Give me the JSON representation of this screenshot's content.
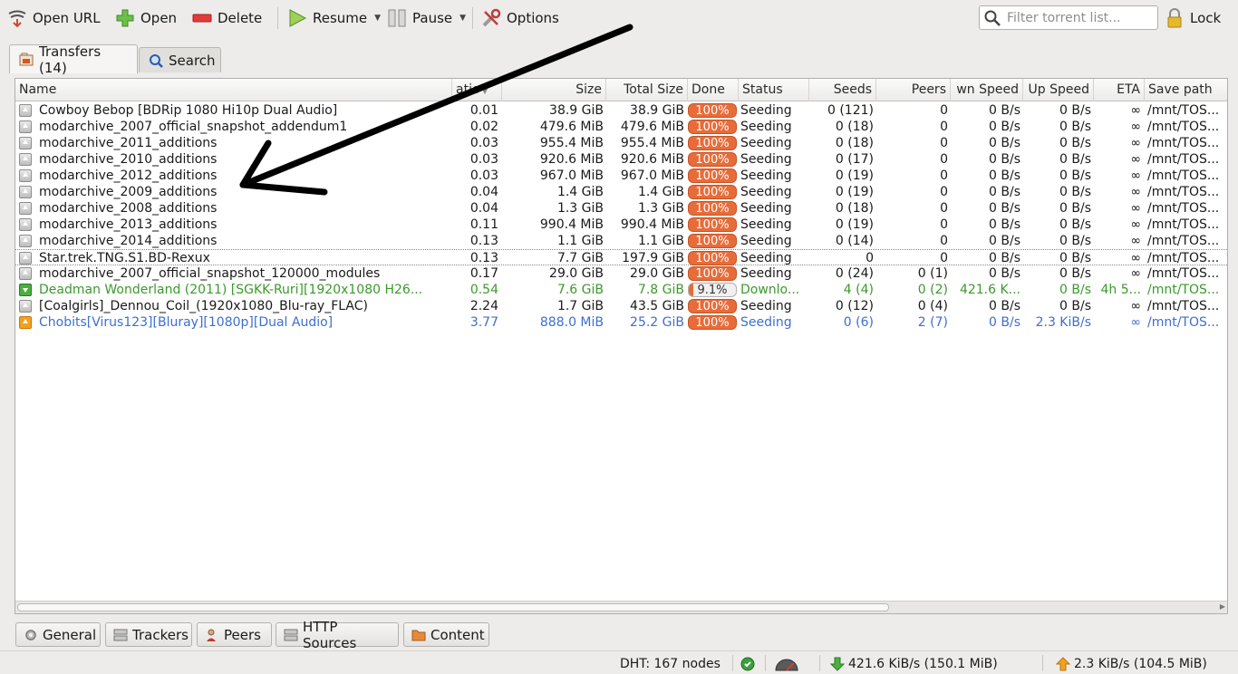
{
  "toolbar": {
    "open_url": "Open URL",
    "open": "Open",
    "delete": "Delete",
    "resume": "Resume",
    "pause": "Pause",
    "options": "Options",
    "filter_placeholder": "Filter torrent list...",
    "lock": "Lock"
  },
  "tabs": {
    "transfers": "Transfers (14)",
    "search": "Search"
  },
  "columns": {
    "name": "Name",
    "ratio": "atio",
    "size": "Size",
    "total_size": "Total Size",
    "done": "Done",
    "status": "Status",
    "seeds": "Seeds",
    "peers": "Peers",
    "down_speed": "wn Speed",
    "up_speed": "Up Speed",
    "eta": "ETA",
    "save_path": "Save path"
  },
  "rows": [
    {
      "name": "Cowboy Bebop [BDRip 1080 Hi10p Dual Audio]",
      "ratio": "0.01",
      "size": "38.9 GiB",
      "total": "38.9 GiB",
      "done": "100%",
      "status": "Seeding",
      "seeds": "0 (121)",
      "peers": "0",
      "down": "0 B/s",
      "up": "0 B/s",
      "eta": "∞",
      "path": "/mnt/TOS..."
    },
    {
      "name": "modarchive_2007_official_snapshot_addendum1",
      "ratio": "0.02",
      "size": "479.6 MiB",
      "total": "479.6 MiB",
      "done": "100%",
      "status": "Seeding",
      "seeds": "0 (18)",
      "peers": "0",
      "down": "0 B/s",
      "up": "0 B/s",
      "eta": "∞",
      "path": "/mnt/TOS..."
    },
    {
      "name": "modarchive_2011_additions",
      "ratio": "0.03",
      "size": "955.4 MiB",
      "total": "955.4 MiB",
      "done": "100%",
      "status": "Seeding",
      "seeds": "0 (18)",
      "peers": "0",
      "down": "0 B/s",
      "up": "0 B/s",
      "eta": "∞",
      "path": "/mnt/TOS..."
    },
    {
      "name": "modarchive_2010_additions",
      "ratio": "0.03",
      "size": "920.6 MiB",
      "total": "920.6 MiB",
      "done": "100%",
      "status": "Seeding",
      "seeds": "0 (17)",
      "peers": "0",
      "down": "0 B/s",
      "up": "0 B/s",
      "eta": "∞",
      "path": "/mnt/TOS..."
    },
    {
      "name": "modarchive_2012_additions",
      "ratio": "0.03",
      "size": "967.0 MiB",
      "total": "967.0 MiB",
      "done": "100%",
      "status": "Seeding",
      "seeds": "0 (19)",
      "peers": "0",
      "down": "0 B/s",
      "up": "0 B/s",
      "eta": "∞",
      "path": "/mnt/TOS..."
    },
    {
      "name": "modarchive_2009_additions",
      "ratio": "0.04",
      "size": "1.4 GiB",
      "total": "1.4 GiB",
      "done": "100%",
      "status": "Seeding",
      "seeds": "0 (19)",
      "peers": "0",
      "down": "0 B/s",
      "up": "0 B/s",
      "eta": "∞",
      "path": "/mnt/TOS..."
    },
    {
      "name": "modarchive_2008_additions",
      "ratio": "0.04",
      "size": "1.3 GiB",
      "total": "1.3 GiB",
      "done": "100%",
      "status": "Seeding",
      "seeds": "0 (18)",
      "peers": "0",
      "down": "0 B/s",
      "up": "0 B/s",
      "eta": "∞",
      "path": "/mnt/TOS..."
    },
    {
      "name": "modarchive_2013_additions",
      "ratio": "0.11",
      "size": "990.4 MiB",
      "total": "990.4 MiB",
      "done": "100%",
      "status": "Seeding",
      "seeds": "0 (19)",
      "peers": "0",
      "down": "0 B/s",
      "up": "0 B/s",
      "eta": "∞",
      "path": "/mnt/TOS..."
    },
    {
      "name": "modarchive_2014_additions",
      "ratio": "0.13",
      "size": "1.1 GiB",
      "total": "1.1 GiB",
      "done": "100%",
      "status": "Seeding",
      "seeds": "0 (14)",
      "peers": "0",
      "down": "0 B/s",
      "up": "0 B/s",
      "eta": "∞",
      "path": "/mnt/TOS..."
    },
    {
      "name": "Star.trek.TNG.S1.BD-Rexux",
      "ratio": "0.13",
      "size": "7.7 GiB",
      "total": "197.9 GiB",
      "done": "100%",
      "status": "Seeding",
      "seeds": "0",
      "peers": "0",
      "down": "0 B/s",
      "up": "0 B/s",
      "eta": "∞",
      "path": "/mnt/TOS...",
      "style": "divider"
    },
    {
      "name": "modarchive_2007_official_snapshot_120000_modules",
      "ratio": "0.17",
      "size": "29.0 GiB",
      "total": "29.0 GiB",
      "done": "100%",
      "status": "Seeding",
      "seeds": "0 (24)",
      "peers": "0 (1)",
      "down": "0 B/s",
      "up": "0 B/s",
      "eta": "∞",
      "path": "/mnt/TOS..."
    },
    {
      "name": "Deadman Wonderland (2011) [SGKK-Ruri][1920x1080 H26...",
      "ratio": "0.54",
      "size": "7.6 GiB",
      "total": "7.8 GiB",
      "done": "9.1%",
      "done_fraction": 0.091,
      "status": "Downlo...",
      "seeds": "4 (4)",
      "peers": "0 (2)",
      "down": "421.6 K...",
      "up": "0 B/s",
      "eta": "4h 5...",
      "path": "/mnt/TOS...",
      "style": "green",
      "icon": "down"
    },
    {
      "name": "[Coalgirls]_Dennou_Coil_(1920x1080_Blu-ray_FLAC)",
      "ratio": "2.24",
      "size": "1.7 GiB",
      "total": "43.5 GiB",
      "done": "100%",
      "status": "Seeding",
      "seeds": "0 (12)",
      "peers": "0 (4)",
      "down": "0 B/s",
      "up": "0 B/s",
      "eta": "∞",
      "path": "/mnt/TOS..."
    },
    {
      "name": "Chobits[Virus123][Bluray][1080p][Dual Audio]",
      "ratio": "3.77",
      "size": "888.0 MiB",
      "total": "25.2 GiB",
      "done": "100%",
      "status": "Seeding",
      "seeds": "0 (6)",
      "peers": "2 (7)",
      "down": "0 B/s",
      "up": "2.3 KiB/s",
      "eta": "∞",
      "path": "/mnt/TOS...",
      "style": "blue",
      "icon": "up"
    }
  ],
  "bottom_tabs": {
    "general": "General",
    "trackers": "Trackers",
    "peers": "Peers",
    "http_sources": "HTTP Sources",
    "content": "Content"
  },
  "statusbar": {
    "dht": "DHT: 167 nodes",
    "down": "421.6 KiB/s (150.1 MiB)",
    "up": "2.3 KiB/s (104.5 MiB)"
  },
  "colors": {
    "progress": "#e86c3a",
    "downloading": "#3a9a2a",
    "uploading": "#3d6fd0"
  }
}
